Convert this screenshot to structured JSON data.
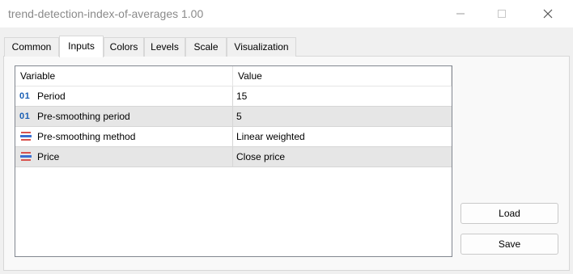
{
  "window": {
    "title": "trend-detection-index-of-averages 1.00"
  },
  "tabs": [
    {
      "label": "Common",
      "active": false
    },
    {
      "label": "Inputs",
      "active": true
    },
    {
      "label": "Colors",
      "active": false
    },
    {
      "label": "Levels",
      "active": false
    },
    {
      "label": "Scale",
      "active": false
    },
    {
      "label": "Visualization",
      "active": false
    }
  ],
  "grid": {
    "columns": [
      "Variable",
      "Value"
    ],
    "rows": [
      {
        "icon": "int-type-icon",
        "icon_text": "01",
        "name": "Period",
        "value": "15"
      },
      {
        "icon": "int-type-icon",
        "icon_text": "01",
        "name": "Pre-smoothing period",
        "value": "5"
      },
      {
        "icon": "enum-type-icon",
        "icon_text": "",
        "name": "Pre-smoothing method",
        "value": "Linear weighted"
      },
      {
        "icon": "enum-type-icon",
        "icon_text": "",
        "name": "Price",
        "value": "Close price"
      }
    ]
  },
  "buttons": {
    "load": "Load",
    "save": "Save"
  },
  "colors": {
    "accent_blue": "#1a5fb4",
    "enum_red": "#d9534f",
    "enum_blue": "#3b6fd1",
    "row_alt": "#e6e6e6"
  }
}
